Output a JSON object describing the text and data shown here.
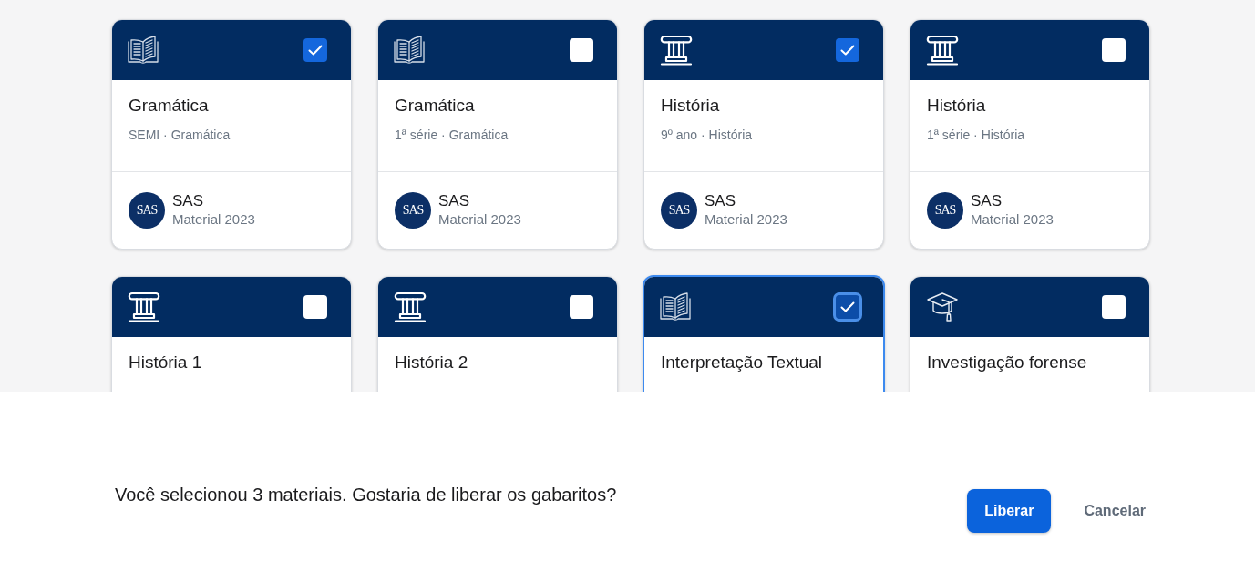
{
  "cards": [
    {
      "kind": "book",
      "checked": true,
      "focused": false,
      "title": "Gramática",
      "subtitle": "SEMI · Gramática",
      "logo": "SAS",
      "publisher": "SAS",
      "material": "Material 2023"
    },
    {
      "kind": "book",
      "checked": false,
      "focused": false,
      "title": "Gramática",
      "subtitle": "1ª série · Gramática",
      "logo": "SAS",
      "publisher": "SAS",
      "material": "Material 2023"
    },
    {
      "kind": "pillar",
      "checked": true,
      "focused": false,
      "title": "História",
      "subtitle": "9º ano · História",
      "logo": "SAS",
      "publisher": "SAS",
      "material": "Material 2023"
    },
    {
      "kind": "pillar",
      "checked": false,
      "focused": false,
      "title": "História",
      "subtitle": "1ª série · História",
      "logo": "SAS",
      "publisher": "SAS",
      "material": "Material 2023"
    },
    {
      "kind": "pillar",
      "checked": false,
      "focused": false,
      "title": "História 1"
    },
    {
      "kind": "pillar",
      "checked": false,
      "focused": false,
      "title": "História 2"
    },
    {
      "kind": "book",
      "checked": true,
      "focused": true,
      "title": "Interpretação Textual"
    },
    {
      "kind": "cap",
      "checked": false,
      "focused": false,
      "title": "Investigação forense"
    }
  ],
  "action_bar": {
    "message": "Você selecionou 3 materiais. Gostaria de liberar os gabaritos?",
    "buttons": [
      {
        "kind": "primary",
        "label": "Liberar"
      },
      {
        "kind": "text",
        "label": "Cancelar"
      }
    ]
  }
}
